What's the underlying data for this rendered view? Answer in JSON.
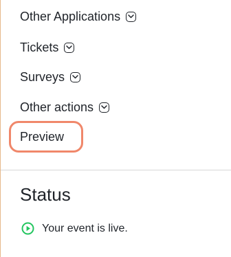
{
  "menu": {
    "items": [
      {
        "label": "Other Applications",
        "icon": "chevron-down-icon"
      },
      {
        "label": "Tickets",
        "icon": "chevron-down-icon"
      },
      {
        "label": "Surveys",
        "icon": "chevron-down-icon"
      },
      {
        "label": "Other actions",
        "icon": "chevron-down-icon"
      }
    ],
    "preview_label": "Preview"
  },
  "status": {
    "title": "Status",
    "message": "Your event is live.",
    "icon": "play-circle-icon",
    "icon_color": "#22c55e"
  },
  "colors": {
    "highlight": "#f0876a",
    "divider": "#d7d7d7",
    "left_border": "#e6b88a"
  }
}
